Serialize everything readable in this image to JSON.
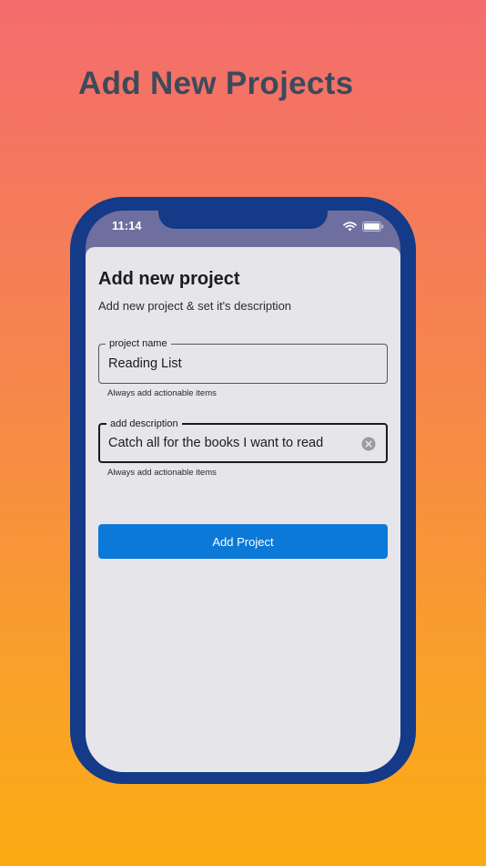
{
  "promo": {
    "headline": "Add New Projects"
  },
  "status_bar": {
    "time": "11:14",
    "icons": [
      "wifi-icon",
      "battery-icon"
    ]
  },
  "sheet": {
    "title": "Add new project",
    "subtitle": "Add new project & set it's description"
  },
  "project_name_field": {
    "label": "project name",
    "value": "Reading List",
    "helper": "Always add actionable items"
  },
  "description_field": {
    "label": "add description",
    "value": "Catch all for the books I want to read",
    "helper": "Always add actionable items",
    "clear_icon": "clear-circle-icon"
  },
  "submit": {
    "label": "Add Project"
  },
  "colors": {
    "gradient_top": "#f46c6e",
    "gradient_bottom": "#fbab12",
    "phone_frame": "#143a88",
    "button": "#0a79d8",
    "sheet_bg": "#e5e5ea",
    "headline": "#3d4a5a"
  }
}
